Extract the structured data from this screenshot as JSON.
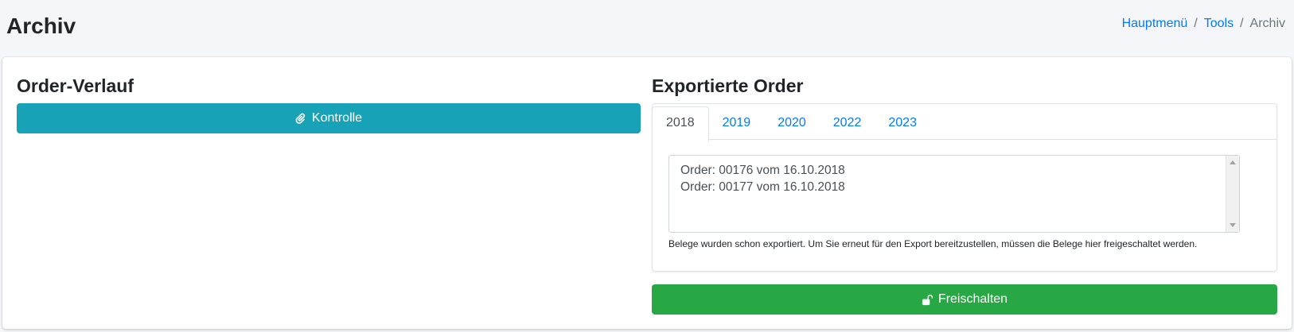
{
  "header": {
    "title": "Archiv",
    "breadcrumb": [
      "Hauptmenü",
      "Tools",
      "Archiv"
    ]
  },
  "left": {
    "title": "Order-Verlauf",
    "button_label": "Kontrolle",
    "button_icon": "paperclip-icon"
  },
  "right": {
    "title": "Exportierte Order",
    "tabs": [
      "2018",
      "2019",
      "2020",
      "2022",
      "2023"
    ],
    "active_tab": "2018",
    "orders": [
      "Order: 00176 vom 16.10.2018",
      "Order: 00177 vom 16.10.2018"
    ],
    "help_text": "Belege wurden schon exportiert. Um Sie erneut für den Export bereitzustellen, müssen die Belege hier freigeschaltet werden.",
    "button_label": "Freischalten",
    "button_icon": "unlock-icon"
  },
  "colors": {
    "info": "#17a2b8",
    "success": "#28a745",
    "link": "#007bff"
  }
}
